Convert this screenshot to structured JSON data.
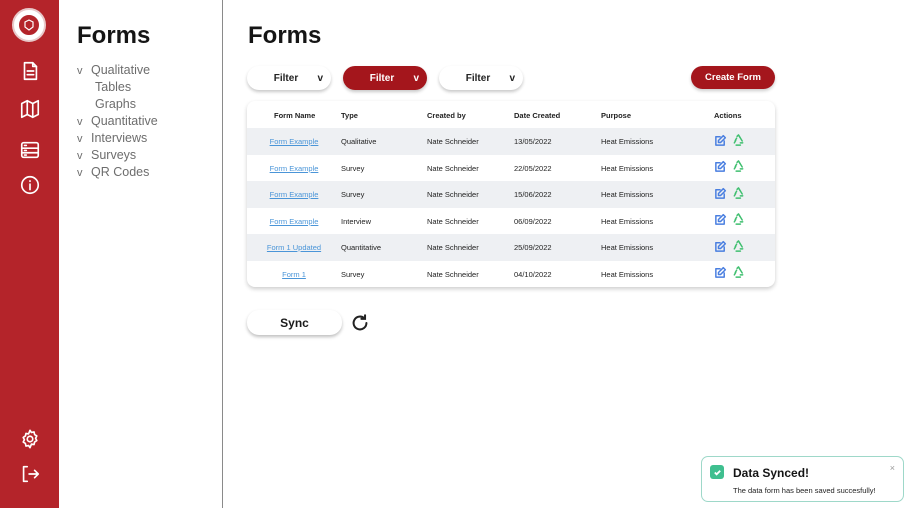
{
  "sidebar_panel": {
    "title": "Forms",
    "items": [
      {
        "caret": "v",
        "label": "Qualitative",
        "sub": false
      },
      {
        "caret": "",
        "label": "Tables",
        "sub": true
      },
      {
        "caret": "",
        "label": "Graphs",
        "sub": true
      },
      {
        "caret": "v",
        "label": "Quantitative",
        "sub": false
      },
      {
        "caret": "v",
        "label": "Interviews",
        "sub": false
      },
      {
        "caret": "v",
        "label": "Surveys",
        "sub": false
      },
      {
        "caret": "v",
        "label": "QR Codes",
        "sub": false
      }
    ]
  },
  "rail": {
    "icons": [
      "document-icon",
      "map-icon",
      "server-icon",
      "info-icon",
      "settings-icon",
      "logout-icon"
    ]
  },
  "main": {
    "title": "Forms",
    "filters": [
      {
        "label": "Filter",
        "chevron": "v",
        "active": false
      },
      {
        "label": "Filter",
        "chevron": "v",
        "active": true
      },
      {
        "label": "Filter",
        "chevron": "v",
        "active": false
      }
    ],
    "create_label": "Create Form",
    "sync_label": "Sync"
  },
  "table": {
    "headers": [
      "Form Name",
      "Type",
      "Created by",
      "Date Created",
      "Purpose",
      "Actions"
    ],
    "rows": [
      [
        "Form Example",
        "Qualitative",
        "Nate Schneider",
        "13/05/2022",
        "Heat Emissions"
      ],
      [
        "Form Example",
        "Survey",
        "Nate Schneider",
        "22/05/2022",
        "Heat Emissions"
      ],
      [
        "Form Example",
        "Survey",
        "Nate Schneider",
        "15/06/2022",
        "Heat Emissions"
      ],
      [
        "Form Example",
        "Interview",
        "Nate Schneider",
        "06/09/2022",
        "Heat Emissions"
      ],
      [
        "Form 1 Updated",
        "Quantitative",
        "Nate Schneider",
        "25/09/2022",
        "Heat Emissions"
      ],
      [
        "Form 1",
        "Survey",
        "Nate Schneider",
        "04/10/2022",
        "Heat Emissions"
      ]
    ]
  },
  "toast": {
    "title": "Data Synced!",
    "message": "The data form has been saved succesfully!",
    "close": "×"
  },
  "colors": {
    "brand_red": "#b4242a",
    "button_red": "#a4161c",
    "link_blue": "#4a95d8",
    "edit_blue": "#4a7fe0",
    "recycle_green": "#3fbf6f",
    "toast_border": "#9ed8c9"
  }
}
